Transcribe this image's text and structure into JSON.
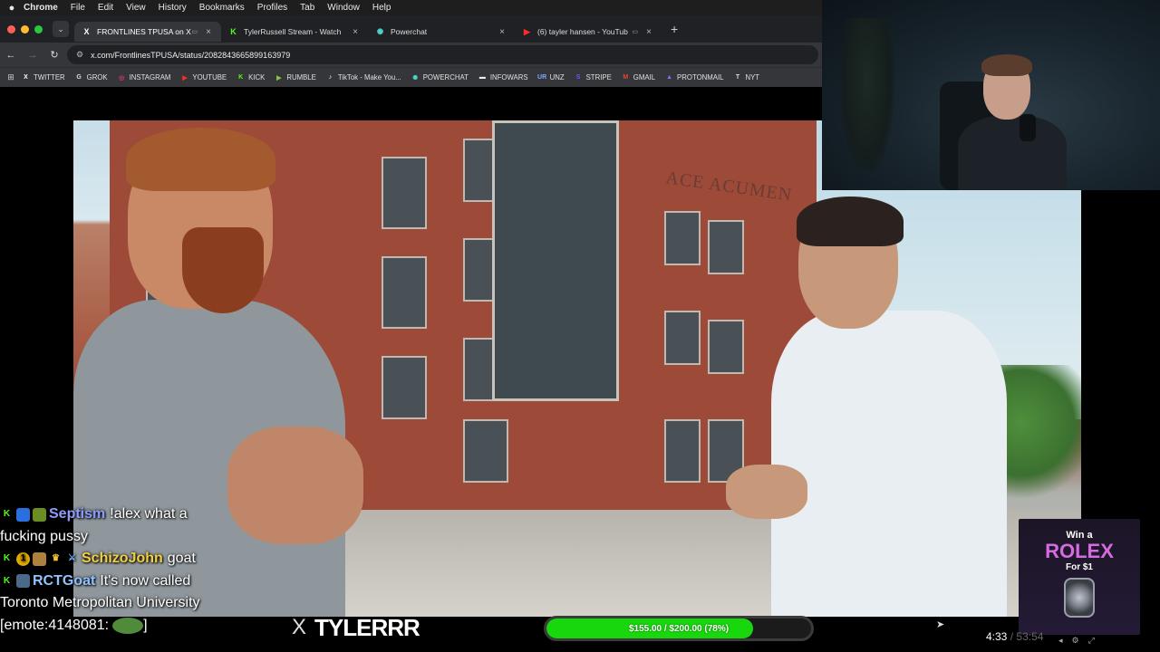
{
  "menubar": {
    "apple_icon": "",
    "items": [
      "Chrome",
      "File",
      "Edit",
      "View",
      "History",
      "Bookmarks",
      "Profiles",
      "Tab",
      "Window",
      "Help"
    ]
  },
  "tabs": [
    {
      "icon": "x-logo-icon",
      "glyph": "X",
      "title": "FRONTLINES TPUSA on X",
      "color": "#ffffff",
      "active": true
    },
    {
      "icon": "kick-logo-icon",
      "glyph": "K",
      "title": "TylerRussell Stream - Watch",
      "color": "#53fc18",
      "active": false
    },
    {
      "icon": "powerchat-logo-icon",
      "glyph": "✺",
      "title": "Powerchat",
      "color": "#4fd1c5",
      "active": false
    },
    {
      "icon": "youtube-logo-icon",
      "glyph": "▶",
      "title": "(6) tayler hansen - YouTub",
      "color": "#ff2a2a",
      "active": false
    }
  ],
  "address": {
    "url": "x.com/FrontlinesTPUSA/status/2082843665899163979"
  },
  "bookmarks": [
    {
      "label": "TWITTER",
      "icon": "x-logo-icon",
      "glyph": "X",
      "color": "#ffffff"
    },
    {
      "label": "GROK",
      "icon": "grok-logo-icon",
      "glyph": "G",
      "color": "#dddddd"
    },
    {
      "label": "INSTAGRAM",
      "icon": "instagram-logo-icon",
      "glyph": "◎",
      "color": "#e1306c"
    },
    {
      "label": "YOUTUBE",
      "icon": "youtube-logo-icon",
      "glyph": "▶",
      "color": "#ff2a2a"
    },
    {
      "label": "KICK",
      "icon": "kick-logo-icon",
      "glyph": "K",
      "color": "#53fc18"
    },
    {
      "label": "RUMBLE",
      "icon": "rumble-logo-icon",
      "glyph": "▶",
      "color": "#85c742"
    },
    {
      "label": "TikTok - Make You...",
      "icon": "tiktok-logo-icon",
      "glyph": "♪",
      "color": "#ffffff"
    },
    {
      "label": "POWERCHAT",
      "icon": "powerchat-logo-icon",
      "glyph": "✺",
      "color": "#4fd1c5"
    },
    {
      "label": "INFOWARS",
      "icon": "infowars-logo-icon",
      "glyph": "▬",
      "color": "#eeeeee"
    },
    {
      "label": "UNZ",
      "icon": "unz-logo-icon",
      "glyph": "UR",
      "color": "#7fa7ff"
    },
    {
      "label": "STRIPE",
      "icon": "stripe-logo-icon",
      "glyph": "S",
      "color": "#635bff"
    },
    {
      "label": "GMAIL",
      "icon": "gmail-logo-icon",
      "glyph": "M",
      "color": "#ea4335"
    },
    {
      "label": "PROTONMAIL",
      "icon": "protonmail-logo-icon",
      "glyph": "▲",
      "color": "#8a6cff"
    },
    {
      "label": "NYT",
      "icon": "nyt-logo-icon",
      "glyph": "T",
      "color": "#dddddd"
    }
  ],
  "video": {
    "building_sign": "ACE ACUMEN"
  },
  "chat": [
    {
      "user": "Septism",
      "user_color": "blue",
      "message": "!alex what a",
      "continuation": "fucking pussy"
    },
    {
      "user": "SchizoJohn",
      "user_color": "yellow",
      "message": "goat",
      "continuation": ""
    },
    {
      "user": "RCTGoat",
      "user_color": "cyan",
      "message": "It's now called",
      "continuation": "Toronto Metropolitan University"
    },
    {
      "user": "",
      "user_color": "",
      "message": "[emote:4148081:",
      "continuation": ""
    }
  ],
  "chat_trailing_bracket": "]",
  "branding": {
    "x_glyph": "X",
    "name": "TYLERRR"
  },
  "goal": {
    "label": "$155.00 / $200.00 (78%)",
    "progress_fraction": 0.78,
    "fill_color": "#18d80d"
  },
  "player": {
    "current_time": "4:33",
    "separator": "/",
    "duration": "53:54"
  },
  "ad": {
    "line1": "Win a",
    "brand": "ROLEX",
    "line3": "For $1"
  }
}
